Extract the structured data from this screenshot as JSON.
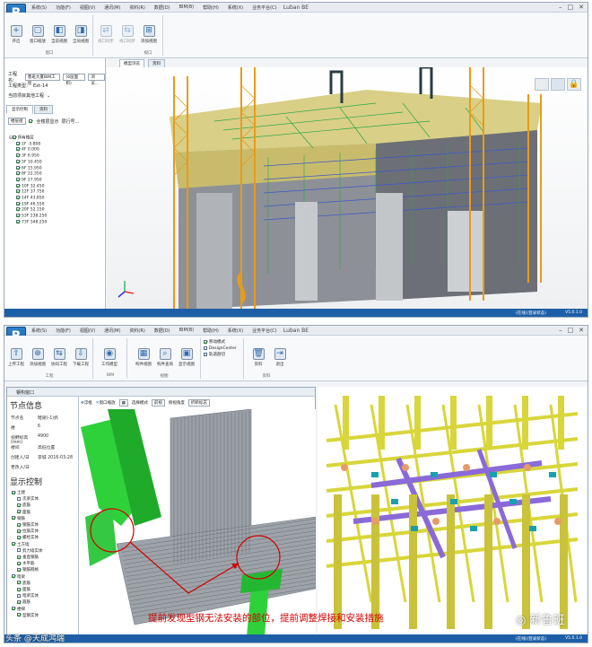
{
  "colors": {
    "accent": "#1d5fa6",
    "annotation": "#d10000",
    "green_steel": "#2fd13b",
    "yellow_steel": "#d8d63a",
    "purple_beam": "#8a6ad8",
    "crane": "#e89b1a"
  },
  "app_title": "Luban BE",
  "menu": [
    "系统(S)",
    "功能(F)",
    "视图(V)",
    "通讯(M)",
    "资料(R)",
    "数据(D)",
    "BIM(B)",
    "帮助(H)",
    "系统(X)",
    "业务平台(C)"
  ],
  "top": {
    "ribbon_buttons": [
      "开启",
      "窗口缩放",
      "当前视图",
      "全局视图",
      "视口同步",
      "视口同步",
      "添加视图"
    ],
    "ribbon_groups": [
      "窗口",
      "视口"
    ],
    "doc_tabs": [
      "模型浏览",
      "资料"
    ],
    "form": {
      "project_label": "工程名:",
      "project_value": "鲁班大厦BIM工程",
      "project_select": "(6层面积)",
      "browse_btn": "浏览...",
      "type_label": "工程类型：",
      "type_value": "Ext-14",
      "section_label": "当前项目其他工程",
      "panel_tabs": [
        "显示控制",
        "资料"
      ],
      "floor_select": "楼层组",
      "view_check": "全楼层显示",
      "extra": "层行号..."
    },
    "tree_root": "所有楼层",
    "floors": [
      "1F -5.800",
      "4F 0.000",
      "3F 6.950",
      "5F 10.450",
      "6F 15.950",
      "8F 22.350",
      "9F 27.950",
      "10F 32.450",
      "12F 37.750",
      "14F 43.850",
      "19F 46.550",
      "20F 52.150",
      "53F 238.250",
      "73F 348.250"
    ],
    "status_left": "",
    "status_right": "V5.0.1.0",
    "status_mid": "(在线)(登录状态)"
  },
  "bottom": {
    "ribbon_buttons": [
      "上传工程",
      "添加视图",
      "协同工程",
      "下载工程",
      "工作模型",
      "构件视图",
      "构件查询",
      "显示视图",
      "资料",
      "退出"
    ],
    "ribbon_groups": [
      "工程",
      "BIM",
      "视图",
      "资料"
    ],
    "checks": [
      "移动模式",
      "DesignCenter",
      "轨道剖切"
    ],
    "node_window_title": "钢构窗口",
    "node_info_title": "节点信息",
    "props": [
      {
        "k": "节点名",
        "v": "暗梁(-1)抓"
      },
      {
        "k": "楼",
        "v": "6"
      },
      {
        "k": "视野标高(mm)",
        "v": "4900"
      },
      {
        "k": "楼间",
        "v": "高低位置"
      },
      {
        "k": "创建人/日",
        "v": "李城 2016-03-28"
      },
      {
        "k": "更改人/日",
        "v": ""
      }
    ],
    "display_title": "显示控制",
    "checklist": [
      {
        "t": "土建",
        "on": true,
        "lv": 0
      },
      {
        "t": "次梁实体",
        "on": false,
        "lv": 1
      },
      {
        "t": "底筋",
        "on": true,
        "lv": 1
      },
      {
        "t": "面筋",
        "on": true,
        "lv": 1
      },
      {
        "t": "钢筋",
        "on": true,
        "lv": 0
      },
      {
        "t": "钢筋实体",
        "on": true,
        "lv": 1
      },
      {
        "t": "拉筋实体",
        "on": true,
        "lv": 1
      },
      {
        "t": "螺栓实体",
        "on": true,
        "lv": 1
      },
      {
        "t": "土方墙",
        "on": true,
        "lv": 0
      },
      {
        "t": "剪力墙实体",
        "on": false,
        "lv": 1
      },
      {
        "t": "垂直钢筋",
        "on": true,
        "lv": 1
      },
      {
        "t": "水平筋",
        "on": true,
        "lv": 1
      },
      {
        "t": "钢筋网格",
        "on": true,
        "lv": 1
      },
      {
        "t": "暗梁",
        "on": true,
        "lv": 0
      },
      {
        "t": "底筋",
        "on": true,
        "lv": 1
      },
      {
        "t": "面筋",
        "on": true,
        "lv": 1
      },
      {
        "t": "暗梁实体",
        "on": false,
        "lv": 1
      },
      {
        "t": "箍筋",
        "on": true,
        "lv": 1
      },
      {
        "t": "楼梯",
        "on": true,
        "lv": 0
      },
      {
        "t": "型钢实体",
        "on": true,
        "lv": 1
      }
    ],
    "toolbar": [
      "浮框",
      "窗口缩放",
      "选择模式",
      "前视",
      "俯视角度",
      "折断标志"
    ],
    "annotation": "提前发现型钢无法安装的部位，提前调整焊接和安装措施",
    "status_mid": "(在线)(登录状态)",
    "status_right": "V5.0.1.0"
  },
  "watermarks": {
    "brand": "新鲁班",
    "corner": "头条 @天成鸿瑞"
  }
}
